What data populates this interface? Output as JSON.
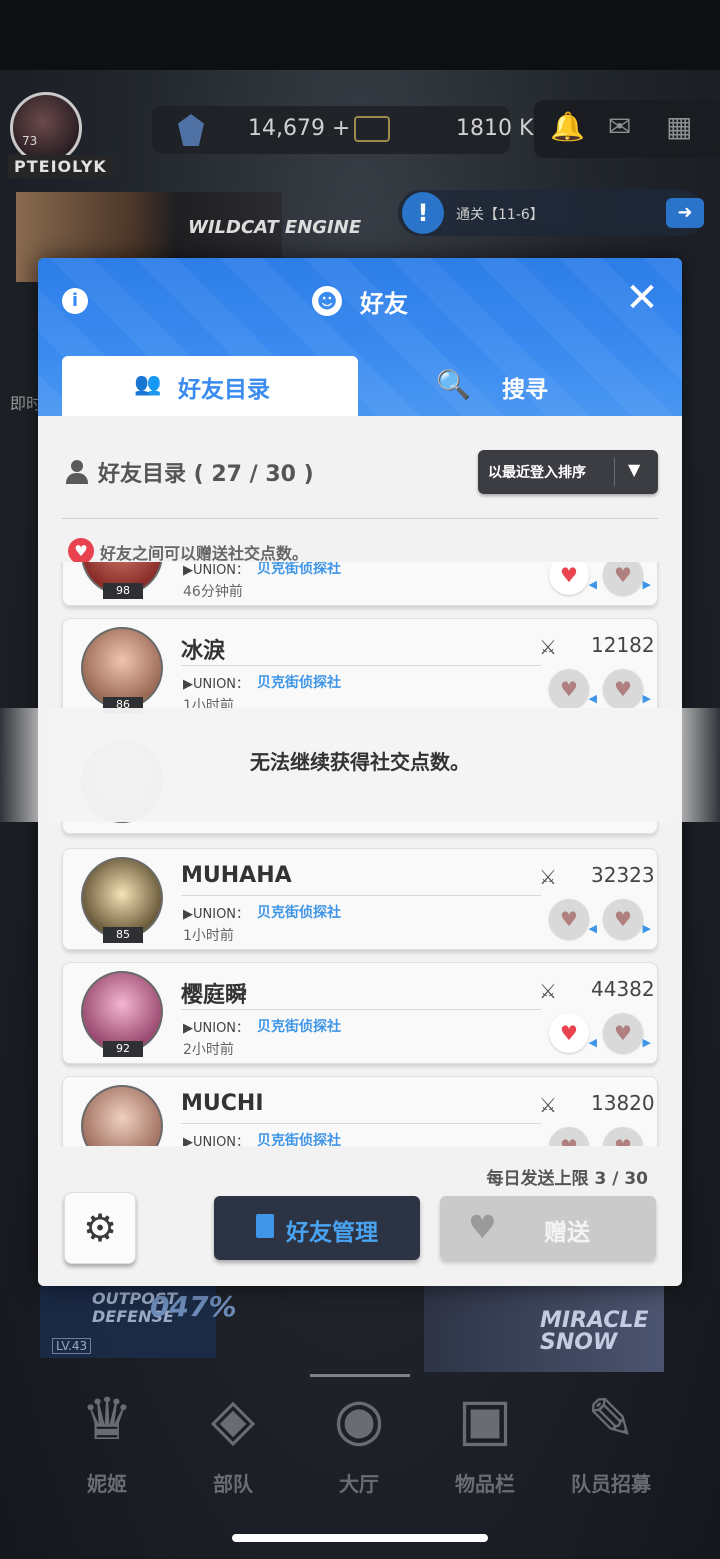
{
  "hud": {
    "avatar_level": "73",
    "player_name": "PTEIOLYK",
    "gems": "14,679",
    "gems_plus": "+",
    "gold": "1810 K",
    "quest_text": "通关【11-6】",
    "banner_text": "WILDCAT ENGINE",
    "side_label": "即时"
  },
  "dialog": {
    "title": "好友",
    "tabs": [
      {
        "label": "好友目录",
        "active": true,
        "icon": "users-icon"
      },
      {
        "label": "搜寻",
        "active": false,
        "icon": "search-icon"
      }
    ],
    "list_title": "好友目录 ( 27 / 30 )",
    "sort_label": "以最近登入排序",
    "hint": "好友之间可以赠送社交点数。",
    "daily_limit": "每日发送上限 3 / 30",
    "manage_label": "好友管理",
    "gift_label": "赠送"
  },
  "friends": [
    {
      "name": "",
      "union_label": "▶UNION：",
      "union": "贝克街侦探社",
      "time": "46分钟前",
      "level": "98",
      "power": "",
      "received_heart": true
    },
    {
      "name": "冰淚",
      "union_label": "▶UNION：",
      "union": "贝克街侦探社",
      "time": "1小时前",
      "level": "86",
      "power": "12182",
      "received_heart": false
    },
    {
      "name": "",
      "union_label": "",
      "union": "",
      "time": "",
      "level": "",
      "power": "",
      "received_heart": false
    },
    {
      "name": "MUHAHA",
      "union_label": "▶UNION：",
      "union": "贝克街侦探社",
      "time": "1小时前",
      "level": "85",
      "power": "32323",
      "received_heart": false
    },
    {
      "name": "樱庭瞬",
      "union_label": "▶UNION：",
      "union": "贝克街侦探社",
      "time": "2小时前",
      "level": "92",
      "power": "44382",
      "received_heart": true
    },
    {
      "name": "MUCHI",
      "union_label": "▶UNION：",
      "union": "贝克街侦探社",
      "time": "",
      "level": "",
      "power": "13820",
      "received_heart": false
    }
  ],
  "toast": "无法继续获得社交点数。",
  "outpost": {
    "title": "OUTPOST DEFENSE",
    "percent": "047%",
    "level": "LV.43"
  },
  "event_banner": "MIRACLE SNOW",
  "nav": [
    {
      "label": "妮姬",
      "icon": "nikke-icon"
    },
    {
      "label": "部队",
      "icon": "squad-icon"
    },
    {
      "label": "大厅",
      "icon": "lobby-icon"
    },
    {
      "label": "物品栏",
      "icon": "inventory-icon"
    },
    {
      "label": "队员招募",
      "icon": "recruit-icon"
    }
  ],
  "colors": {
    "accent": "#3a8bf0",
    "union": "#3f95e6",
    "heart_active": "#e8434f"
  }
}
